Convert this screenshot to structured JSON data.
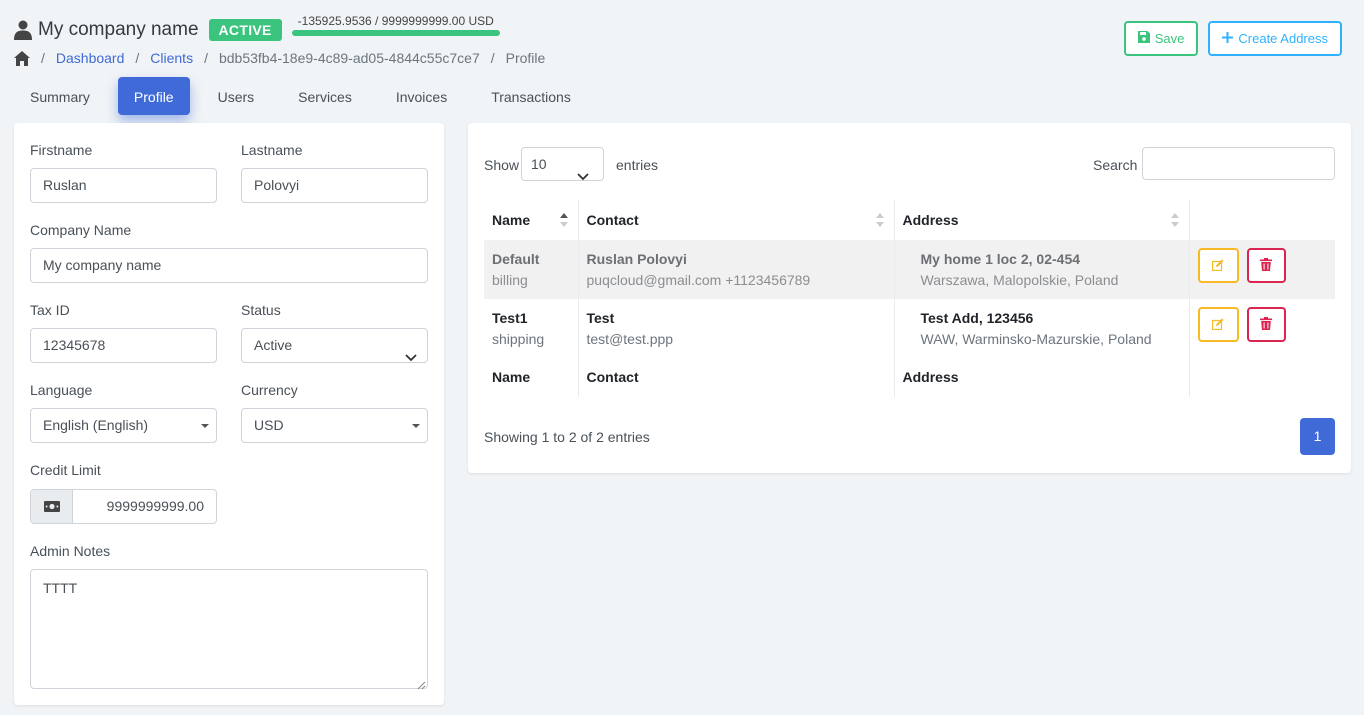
{
  "header": {
    "company_name": "My company name",
    "status_badge": "ACTIVE",
    "balance": "-135925.9536 / 9999999999.00 USD",
    "save_label": "Save",
    "create_address_label": "Create Address",
    "colors": {
      "success": "#3ac47d",
      "info": "#30b1ff",
      "primary": "#3f6ad8",
      "danger": "#d92550",
      "warning": "#f7b924"
    }
  },
  "breadcrumb": {
    "dashboard": "Dashboard",
    "clients": "Clients",
    "client_id": "bdb53fb4-18e9-4c89-ad05-4844c55c7ce7",
    "current": "Profile"
  },
  "tabs": [
    {
      "label": "Summary"
    },
    {
      "label": "Profile",
      "active": true
    },
    {
      "label": "Users"
    },
    {
      "label": "Services"
    },
    {
      "label": "Invoices"
    },
    {
      "label": "Transactions"
    }
  ],
  "form": {
    "firstname_label": "Firstname",
    "firstname_value": "Ruslan",
    "lastname_label": "Lastname",
    "lastname_value": "Polovyi",
    "company_label": "Company Name",
    "company_value": "My company name",
    "tax_label": "Tax ID",
    "tax_value": "12345678",
    "status_label": "Status",
    "status_value": "Active",
    "language_label": "Language",
    "language_value": "English (English)",
    "currency_label": "Currency",
    "currency_value": "USD",
    "credit_label": "Credit Limit",
    "credit_value": "9999999999.00",
    "notes_label": "Admin Notes",
    "notes_value": "TTTT"
  },
  "table": {
    "show_label": "Show",
    "page_size": "10",
    "entries_label": "entries",
    "search_label": "Search",
    "headers": {
      "name": "Name",
      "contact": "Contact",
      "address": "Address"
    },
    "rows": [
      {
        "name": "Default",
        "type": "billing",
        "contact_name": "Ruslan Polovyi",
        "contact_detail": "puqcloud@gmail.com +1123456789",
        "address_line": "My home 1 loc 2, 02-454",
        "address_region": "Warszawa, Malopolskie, Poland"
      },
      {
        "name": "Test1",
        "type": "shipping",
        "contact_name": "Test",
        "contact_detail": "test@test.ppp",
        "address_line": "Test Add, 123456",
        "address_region": "WAW, Warminsko-Mazurskie, Poland"
      }
    ],
    "info": "Showing 1 to 2 of 2 entries",
    "page": "1"
  }
}
